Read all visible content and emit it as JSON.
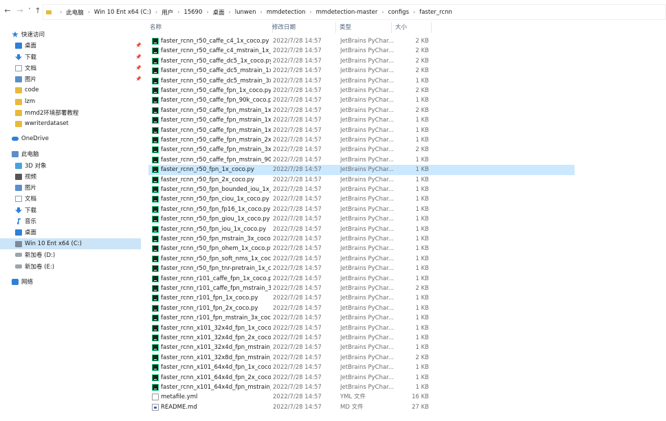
{
  "address_bar": {
    "breadcrumbs": [
      "此电脑",
      "Win 10 Ent x64 (C:)",
      "用户",
      "15690",
      "桌面",
      "lunwen",
      "mmdetection",
      "mmdetection-master",
      "configs",
      "faster_rcnn"
    ]
  },
  "nav": {
    "quick_access": "快速访问",
    "quick_items": [
      {
        "label": "桌面",
        "icon": "desktop-icon",
        "pinned": true
      },
      {
        "label": "下载",
        "icon": "download-icon",
        "pinned": true
      },
      {
        "label": "文档",
        "icon": "document-icon",
        "pinned": true
      },
      {
        "label": "图片",
        "icon": "picture-icon",
        "pinned": true
      },
      {
        "label": "code",
        "icon": "folder-icon",
        "pinned": false
      },
      {
        "label": "lzm",
        "icon": "folder-icon",
        "pinned": false
      },
      {
        "label": "mmd2环境部署教程",
        "icon": "folder-icon",
        "pinned": false
      },
      {
        "label": "wwriterdataset",
        "icon": "folder-icon",
        "pinned": false
      }
    ],
    "onedrive": "OneDrive",
    "this_pc": "此电脑",
    "pc_items": [
      {
        "label": "3D 对象",
        "icon": "3d-objects-icon"
      },
      {
        "label": "视频",
        "icon": "video-icon"
      },
      {
        "label": "图片",
        "icon": "picture-icon"
      },
      {
        "label": "文档",
        "icon": "document-icon"
      },
      {
        "label": "下载",
        "icon": "download-icon"
      },
      {
        "label": "音乐",
        "icon": "music-icon"
      },
      {
        "label": "桌面",
        "icon": "desktop-icon"
      },
      {
        "label": "Win 10 Ent x64 (C:)",
        "icon": "drive-c-icon"
      },
      {
        "label": "新加卷 (D:)",
        "icon": "drive-icon"
      },
      {
        "label": "新加卷 (E:)",
        "icon": "drive-icon"
      }
    ],
    "network": "网络"
  },
  "columns": {
    "name": "名称",
    "date": "修改日期",
    "type": "类型",
    "size": "大小"
  },
  "files": [
    {
      "name": "faster_rcnn_r50_caffe_c4_1x_coco.py",
      "date": "2022/7/28 14:57",
      "type": "JetBrains PyChar...",
      "size": "2 KB",
      "kind": "py"
    },
    {
      "name": "faster_rcnn_r50_caffe_c4_mstrain_1x_c...",
      "date": "2022/7/28 14:57",
      "type": "JetBrains PyChar...",
      "size": "2 KB",
      "kind": "py"
    },
    {
      "name": "faster_rcnn_r50_caffe_dc5_1x_coco.py",
      "date": "2022/7/28 14:57",
      "type": "JetBrains PyChar...",
      "size": "2 KB",
      "kind": "py"
    },
    {
      "name": "faster_rcnn_r50_caffe_dc5_mstrain_1x...",
      "date": "2022/7/28 14:57",
      "type": "JetBrains PyChar...",
      "size": "2 KB",
      "kind": "py"
    },
    {
      "name": "faster_rcnn_r50_caffe_dc5_mstrain_3x...",
      "date": "2022/7/28 14:57",
      "type": "JetBrains PyChar...",
      "size": "1 KB",
      "kind": "py"
    },
    {
      "name": "faster_rcnn_r50_caffe_fpn_1x_coco.py",
      "date": "2022/7/28 14:57",
      "type": "JetBrains PyChar...",
      "size": "2 KB",
      "kind": "py"
    },
    {
      "name": "faster_rcnn_r50_caffe_fpn_90k_coco.py",
      "date": "2022/7/28 14:57",
      "type": "JetBrains PyChar...",
      "size": "1 KB",
      "kind": "py"
    },
    {
      "name": "faster_rcnn_r50_caffe_fpn_mstrain_1x_...",
      "date": "2022/7/28 14:57",
      "type": "JetBrains PyChar...",
      "size": "2 KB",
      "kind": "py"
    },
    {
      "name": "faster_rcnn_r50_caffe_fpn_mstrain_1x_...",
      "date": "2022/7/28 14:57",
      "type": "JetBrains PyChar...",
      "size": "1 KB",
      "kind": "py"
    },
    {
      "name": "faster_rcnn_r50_caffe_fpn_mstrain_1x_...",
      "date": "2022/7/28 14:57",
      "type": "JetBrains PyChar...",
      "size": "1 KB",
      "kind": "py"
    },
    {
      "name": "faster_rcnn_r50_caffe_fpn_mstrain_2x_...",
      "date": "2022/7/28 14:57",
      "type": "JetBrains PyChar...",
      "size": "1 KB",
      "kind": "py"
    },
    {
      "name": "faster_rcnn_r50_caffe_fpn_mstrain_3x_...",
      "date": "2022/7/28 14:57",
      "type": "JetBrains PyChar...",
      "size": "2 KB",
      "kind": "py"
    },
    {
      "name": "faster_rcnn_r50_caffe_fpn_mstrain_90...",
      "date": "2022/7/28 14:57",
      "type": "JetBrains PyChar...",
      "size": "1 KB",
      "kind": "py"
    },
    {
      "name": "faster_rcnn_r50_fpn_1x_coco.py",
      "date": "2022/7/28 14:57",
      "type": "JetBrains PyChar...",
      "size": "1 KB",
      "kind": "py",
      "selected": true
    },
    {
      "name": "faster_rcnn_r50_fpn_2x_coco.py",
      "date": "2022/7/28 14:57",
      "type": "JetBrains PyChar...",
      "size": "1 KB",
      "kind": "py"
    },
    {
      "name": "faster_rcnn_r50_fpn_bounded_iou_1x_...",
      "date": "2022/7/28 14:57",
      "type": "JetBrains PyChar...",
      "size": "1 KB",
      "kind": "py"
    },
    {
      "name": "faster_rcnn_r50_fpn_ciou_1x_coco.py",
      "date": "2022/7/28 14:57",
      "type": "JetBrains PyChar...",
      "size": "1 KB",
      "kind": "py"
    },
    {
      "name": "faster_rcnn_r50_fpn_fp16_1x_coco.py",
      "date": "2022/7/28 14:57",
      "type": "JetBrains PyChar...",
      "size": "1 KB",
      "kind": "py"
    },
    {
      "name": "faster_rcnn_r50_fpn_giou_1x_coco.py",
      "date": "2022/7/28 14:57",
      "type": "JetBrains PyChar...",
      "size": "1 KB",
      "kind": "py"
    },
    {
      "name": "faster_rcnn_r50_fpn_iou_1x_coco.py",
      "date": "2022/7/28 14:57",
      "type": "JetBrains PyChar...",
      "size": "1 KB",
      "kind": "py"
    },
    {
      "name": "faster_rcnn_r50_fpn_mstrain_3x_coco...",
      "date": "2022/7/28 14:57",
      "type": "JetBrains PyChar...",
      "size": "1 KB",
      "kind": "py"
    },
    {
      "name": "faster_rcnn_r50_fpn_ohem_1x_coco.py",
      "date": "2022/7/28 14:57",
      "type": "JetBrains PyChar...",
      "size": "1 KB",
      "kind": "py"
    },
    {
      "name": "faster_rcnn_r50_fpn_soft_nms_1x_coc...",
      "date": "2022/7/28 14:57",
      "type": "JetBrains PyChar...",
      "size": "1 KB",
      "kind": "py"
    },
    {
      "name": "faster_rcnn_r50_fpn_tnr-pretrain_1x_c...",
      "date": "2022/7/28 14:57",
      "type": "JetBrains PyChar...",
      "size": "1 KB",
      "kind": "py"
    },
    {
      "name": "faster_rcnn_r101_caffe_fpn_1x_coco.py",
      "date": "2022/7/28 14:57",
      "type": "JetBrains PyChar...",
      "size": "1 KB",
      "kind": "py"
    },
    {
      "name": "faster_rcnn_r101_caffe_fpn_mstrain_3...",
      "date": "2022/7/28 14:57",
      "type": "JetBrains PyChar...",
      "size": "2 KB",
      "kind": "py"
    },
    {
      "name": "faster_rcnn_r101_fpn_1x_coco.py",
      "date": "2022/7/28 14:57",
      "type": "JetBrains PyChar...",
      "size": "1 KB",
      "kind": "py"
    },
    {
      "name": "faster_rcnn_r101_fpn_2x_coco.py",
      "date": "2022/7/28 14:57",
      "type": "JetBrains PyChar...",
      "size": "1 KB",
      "kind": "py"
    },
    {
      "name": "faster_rcnn_r101_fpn_mstrain_3x_coc...",
      "date": "2022/7/28 14:57",
      "type": "JetBrains PyChar...",
      "size": "1 KB",
      "kind": "py"
    },
    {
      "name": "faster_rcnn_x101_32x4d_fpn_1x_coco...",
      "date": "2022/7/28 14:57",
      "type": "JetBrains PyChar...",
      "size": "1 KB",
      "kind": "py"
    },
    {
      "name": "faster_rcnn_x101_32x4d_fpn_2x_coco...",
      "date": "2022/7/28 14:57",
      "type": "JetBrains PyChar...",
      "size": "1 KB",
      "kind": "py"
    },
    {
      "name": "faster_rcnn_x101_32x4d_fpn_mstrain_...",
      "date": "2022/7/28 14:57",
      "type": "JetBrains PyChar...",
      "size": "1 KB",
      "kind": "py"
    },
    {
      "name": "faster_rcnn_x101_32x8d_fpn_mstrain_...",
      "date": "2022/7/28 14:57",
      "type": "JetBrains PyChar...",
      "size": "2 KB",
      "kind": "py"
    },
    {
      "name": "faster_rcnn_x101_64x4d_fpn_1x_coco...",
      "date": "2022/7/28 14:57",
      "type": "JetBrains PyChar...",
      "size": "1 KB",
      "kind": "py"
    },
    {
      "name": "faster_rcnn_x101_64x4d_fpn_2x_coco...",
      "date": "2022/7/28 14:57",
      "type": "JetBrains PyChar...",
      "size": "1 KB",
      "kind": "py"
    },
    {
      "name": "faster_rcnn_x101_64x4d_fpn_mstrain_...",
      "date": "2022/7/28 14:57",
      "type": "JetBrains PyChar...",
      "size": "1 KB",
      "kind": "py"
    },
    {
      "name": "metafile.yml",
      "date": "2022/7/28 14:57",
      "type": "YML 文件",
      "size": "16 KB",
      "kind": "doc"
    },
    {
      "name": "README.md",
      "date": "2022/7/28 14:57",
      "type": "MD 文件",
      "size": "27 KB",
      "kind": "md"
    }
  ],
  "colors": {
    "selected_row": "#cce8ff",
    "selected_nav": "#cce4f7",
    "folder": "#e8b93b",
    "pycharm_green": "#21d789"
  }
}
